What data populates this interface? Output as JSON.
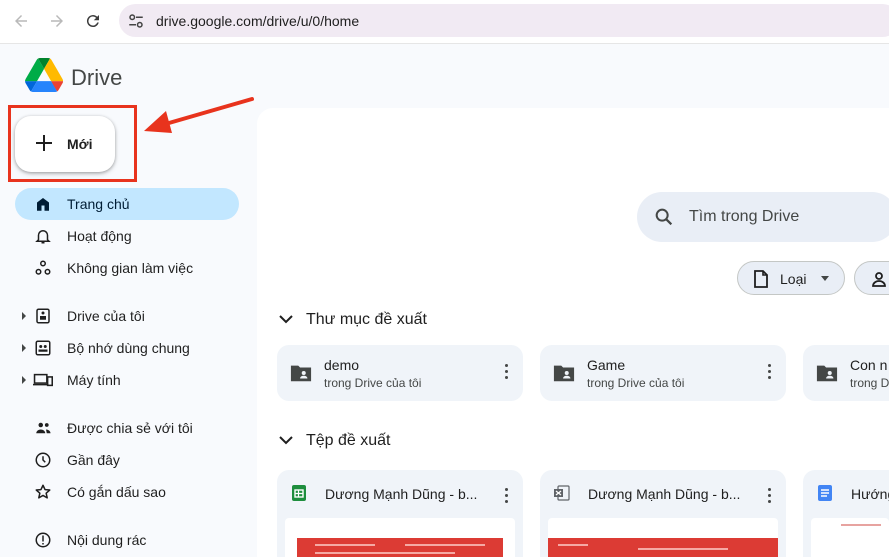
{
  "browser": {
    "url": "drive.google.com/drive/u/0/home"
  },
  "app": {
    "name": "Drive"
  },
  "new_button": {
    "label": "Mới"
  },
  "sidebar": {
    "items": [
      {
        "label": "Trang chủ",
        "icon": "home-icon",
        "active": true
      },
      {
        "label": "Hoạt động",
        "icon": "bell-icon"
      },
      {
        "label": "Không gian làm việc",
        "icon": "workspaces-icon"
      },
      {
        "label": "Drive của tôi",
        "icon": "my-drive-icon",
        "expandable": true
      },
      {
        "label": "Bộ nhớ dùng chung",
        "icon": "shared-drives-icon",
        "expandable": true
      },
      {
        "label": "Máy tính",
        "icon": "computers-icon",
        "expandable": true
      },
      {
        "label": "Được chia sẻ với tôi",
        "icon": "shared-with-me-icon"
      },
      {
        "label": "Gần đây",
        "icon": "clock-icon"
      },
      {
        "label": "Có gắn dấu sao",
        "icon": "star-icon"
      },
      {
        "label": "Nội dung rác",
        "icon": "spam-icon"
      }
    ]
  },
  "search": {
    "placeholder": "Tìm trong Drive"
  },
  "filters": {
    "type_label": "Loại"
  },
  "suggested_folders": {
    "title": "Thư mục đề xuất",
    "items": [
      {
        "name": "demo",
        "location": "trong Drive của tôi"
      },
      {
        "name": "Game",
        "location": "trong Drive của tôi"
      },
      {
        "name": "Con n",
        "location": "trong D"
      }
    ]
  },
  "suggested_files": {
    "title": "Tệp đề xuất",
    "items": [
      {
        "name": "Dương Mạnh Dũng - b...",
        "type": "sheets"
      },
      {
        "name": "Dương Mạnh Dũng - b...",
        "type": "excel"
      },
      {
        "name": "Hướng",
        "type": "docs"
      }
    ]
  },
  "colors": {
    "accent_active": "#c2e7ff",
    "annotation_red": "#e8331d",
    "sheets_green": "#1e8e3e",
    "docs_blue": "#4285f4"
  }
}
